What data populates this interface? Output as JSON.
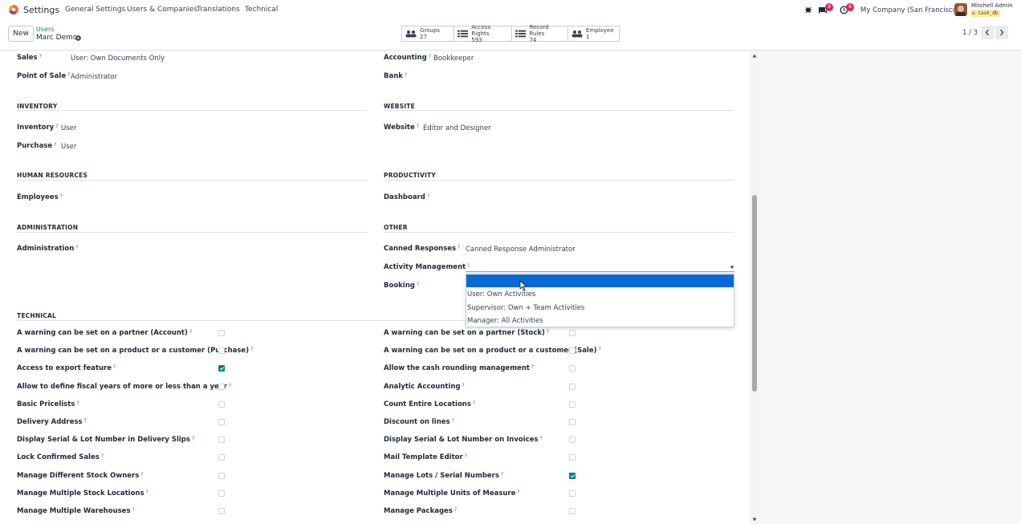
{
  "nav": {
    "app_title": "Settings",
    "menu": [
      "General Settings",
      "Users & Companies",
      "Translations",
      "Technical"
    ],
    "messages_count": "9",
    "activities_count": "6",
    "company": "My Company (San Francisco)",
    "user_name": "Mitchell Admin",
    "db_name": "task_db"
  },
  "control": {
    "new_label": "New",
    "breadcrumb_parent": "Users",
    "record_name": "Marc Demo",
    "stats": [
      {
        "label": "Groups",
        "value": "27",
        "icon": "users-icon"
      },
      {
        "label": "Access Rights",
        "value": "593",
        "icon": "list-icon"
      },
      {
        "label": "Record Rules",
        "value": "74",
        "icon": "list-icon"
      },
      {
        "label": "Employee",
        "value": "1",
        "icon": "users-icon"
      }
    ],
    "pager": "1 / 3"
  },
  "form": {
    "left_top": [
      {
        "label": "Sales",
        "value": "User: Own Documents Only"
      },
      {
        "label": "Point of Sale",
        "value": "Administrator"
      }
    ],
    "right_top": [
      {
        "label": "Accounting",
        "value": "Bookkeeper"
      },
      {
        "label": "Bank",
        "value": ""
      }
    ],
    "sections": {
      "inventory": "INVENTORY",
      "website": "WEBSITE",
      "hr": "HUMAN RESOURCES",
      "productivity": "PRODUCTIVITY",
      "administration": "ADMINISTRATION",
      "other": "OTHER",
      "technical": "TECHNICAL"
    },
    "inventory": [
      {
        "label": "Inventory",
        "value": "User"
      },
      {
        "label": "Purchase",
        "value": "User"
      }
    ],
    "website": [
      {
        "label": "Website",
        "value": "Editor and Designer"
      }
    ],
    "hr": [
      {
        "label": "Employees",
        "value": ""
      }
    ],
    "productivity": [
      {
        "label": "Dashboard",
        "value": ""
      }
    ],
    "administration": [
      {
        "label": "Administration",
        "value": ""
      }
    ],
    "other": [
      {
        "label": "Canned Responses",
        "value": "Canned Response Administrator"
      },
      {
        "label": "Activity Management",
        "value": ""
      },
      {
        "label": "Booking",
        "value": ""
      }
    ],
    "technical_left": [
      {
        "label": "A warning can be set on a partner (Account)",
        "checked": false
      },
      {
        "label": "A warning can be set on a product or a customer (Purchase)",
        "checked": false
      },
      {
        "label": "Access to export feature",
        "checked": true
      },
      {
        "label": "Allow to define fiscal years of more or less than a year",
        "checked": false
      },
      {
        "label": "Basic Pricelists",
        "checked": false
      },
      {
        "label": "Delivery Address",
        "checked": false
      },
      {
        "label": "Display Serial & Lot Number in Delivery Slips",
        "checked": false
      },
      {
        "label": "Lock Confirmed Sales",
        "checked": false
      },
      {
        "label": "Manage Different Stock Owners",
        "checked": false
      },
      {
        "label": "Manage Multiple Stock Locations",
        "checked": false
      },
      {
        "label": "Manage Multiple Warehouses",
        "checked": false
      }
    ],
    "technical_right": [
      {
        "label": "A warning can be set on a partner (Stock)",
        "checked": false
      },
      {
        "label": "A warning can be set on a product or a customer (Sale)",
        "checked": false
      },
      {
        "label": "Allow the cash rounding management",
        "checked": false
      },
      {
        "label": "Analytic Accounting",
        "checked": false
      },
      {
        "label": "Count Entire Locations",
        "checked": false
      },
      {
        "label": "Discount on lines",
        "checked": false
      },
      {
        "label": "Display Serial & Lot Number on Invoices",
        "checked": false
      },
      {
        "label": "Mail Template Editor",
        "checked": false
      },
      {
        "label": "Manage Lots / Serial Numbers",
        "checked": true
      },
      {
        "label": "Manage Multiple Units of Measure",
        "checked": false
      },
      {
        "label": "Manage Packages",
        "checked": false
      }
    ]
  },
  "dropdown": {
    "options": [
      "",
      "User: Own Activities",
      "Supervisor: Own + Team Activities",
      "Manager: All Activities"
    ]
  },
  "colors": {
    "accent": "#017e84",
    "selected": "#0a6ad5",
    "badge": "#e0245e"
  }
}
